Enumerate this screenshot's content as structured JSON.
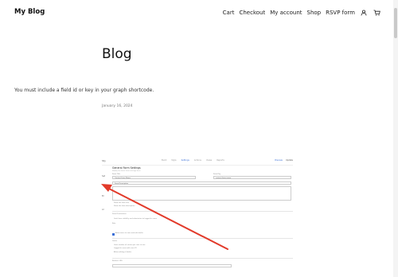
{
  "header": {
    "site_title": "My Blog",
    "nav": [
      {
        "label": "Cart"
      },
      {
        "label": "Checkout"
      },
      {
        "label": "My account"
      },
      {
        "label": "Shop"
      },
      {
        "label": "RSVP form"
      }
    ],
    "icons": [
      "user-icon",
      "cart-icon"
    ]
  },
  "main": {
    "title": "Blog",
    "notice": "You must include a field id or key in your graph shortcode.",
    "date": "January 16, 2024"
  },
  "embedded_screenshot": {
    "header_title": "Sty",
    "nav": [
      "Build",
      "Style",
      "Settings",
      "Actions",
      "Views",
      "Reports"
    ],
    "active_nav": "Settings",
    "right_buttons": [
      "Preview",
      "Update"
    ],
    "form_title": "General Form Settings",
    "form_subtitle": "Modify the basic form settings here.",
    "field_label_title": "Form Title",
    "field_value_title": "Contact Form Name",
    "field_label_key": "Form Key",
    "field_value_key": "contact-form-name",
    "field_label_desc": "Form Description",
    "option1": "Show the form title",
    "option2": "Show the form description",
    "section_label": "Form Permissions",
    "permission_text": "Limit form visibility and submission to logged in users",
    "role_label": "Role",
    "checkbox_label": "Allow users to save and edit drafts",
    "section2_label": "Limits",
    "limit_text1": "Limit number of entries per user to one",
    "limit_text2": "Logged in users with user ID",
    "limit_text3": "Allow editing of drafts",
    "section3_label": "Redirect URL",
    "side_labels": [
      "Set",
      "Bl",
      "Ar"
    ]
  },
  "colors": {
    "arrow": "#e23a2a",
    "accent": "#3b6fd6"
  }
}
